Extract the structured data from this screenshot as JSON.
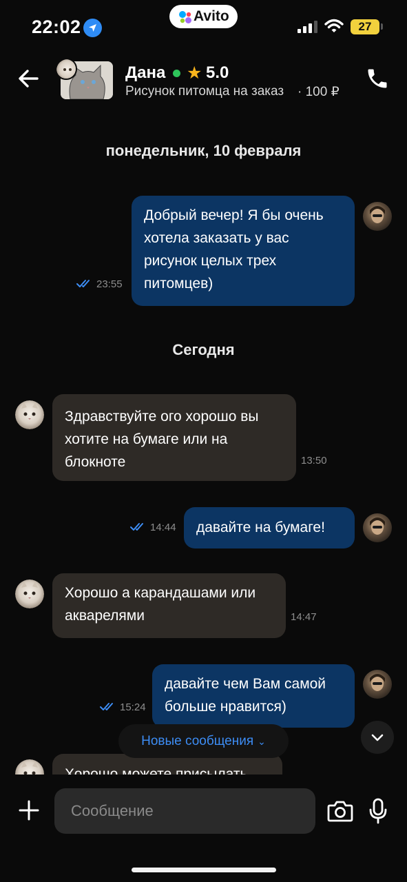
{
  "status_bar": {
    "time": "22:02",
    "battery": "27",
    "brand": "Avito"
  },
  "header": {
    "contact_name": "Дана",
    "rating": "5.0",
    "listing_title": "Рисунок питомца на заказ",
    "listing_price": "· 100 ₽"
  },
  "dates": {
    "first": "понедельник, 10 февраля",
    "today": "Сегодня"
  },
  "messages": [
    {
      "direction": "out",
      "text": "Добрый вечер! Я бы очень хотела заказать у вас рисунок целых трех питомцев)",
      "time": "23:55",
      "read": true
    },
    {
      "direction": "in",
      "text": "Здравствуйте ого хорошо вы хотите на бумаге или на блокноте",
      "time": "13:50"
    },
    {
      "direction": "out",
      "text": "давайте на бумаге!",
      "time": "14:44",
      "read": true
    },
    {
      "direction": "in",
      "text": "Хорошо а карандашами или акварелями",
      "time": "14:47"
    },
    {
      "direction": "out",
      "text": "давайте чем Вам самой больше нравится)",
      "time": "15:24",
      "read": true
    },
    {
      "direction": "in",
      "text": "Хорошо можете присылать",
      "time": ""
    }
  ],
  "new_messages_label": "Новые сообщения",
  "composer": {
    "placeholder": "Сообщение"
  },
  "colors": {
    "background": "#0a0a0a",
    "outgoing_bubble": "#0c3563",
    "incoming_bubble": "#2e2a26",
    "accent_blue": "#3d8df5",
    "online_green": "#2ec45a",
    "star": "#f9b41c",
    "battery": "#f2d13d"
  },
  "icons": [
    "location-arrow-icon",
    "signal-icon",
    "wifi-icon",
    "battery-icon",
    "back-arrow-icon",
    "online-dot-icon",
    "star-icon",
    "phone-icon",
    "double-check-icon",
    "chevron-down-icon",
    "plus-icon",
    "camera-icon",
    "microphone-icon"
  ]
}
